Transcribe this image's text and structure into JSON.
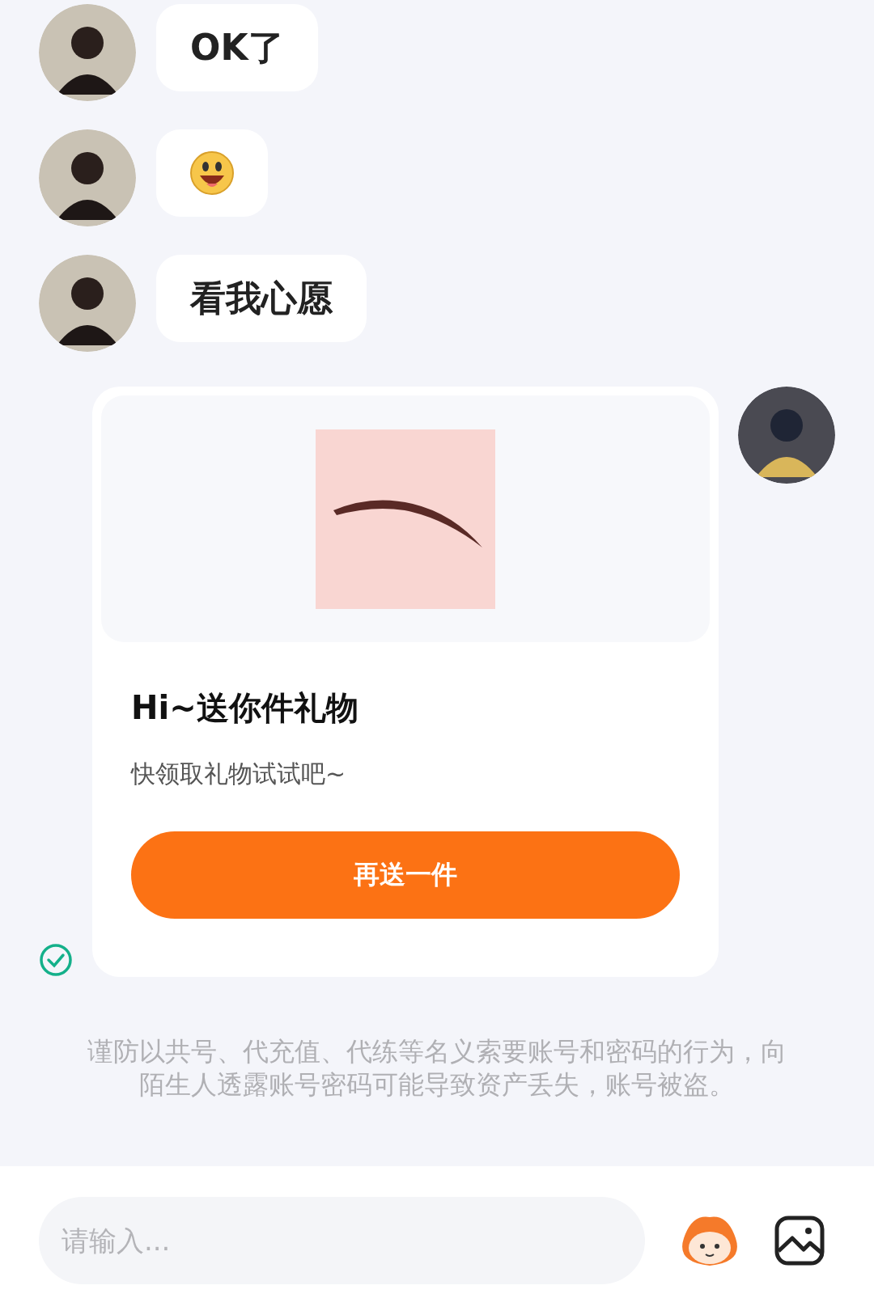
{
  "messages": [
    {
      "kind": "text",
      "text": "OK了"
    },
    {
      "kind": "emoji"
    },
    {
      "kind": "text",
      "text": "看我心愿"
    }
  ],
  "gift_card": {
    "title": "Hi~送你件礼物",
    "subtitle": "快领取礼物试试吧~",
    "button": "再送一件",
    "delivered": true
  },
  "notice": "谨防以共号、代充值、代练等名义索要账号和密码的行为，向陌生人透露账号密码可能导致资产丢失，账号被盗。",
  "input": {
    "placeholder": "请输入..."
  }
}
